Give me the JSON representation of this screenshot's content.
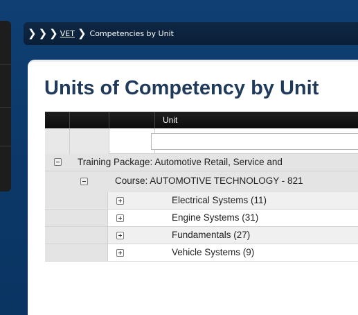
{
  "breadcrumb": {
    "link_label": "VET",
    "current_label": "Competencies by Unit"
  },
  "page": {
    "title": "Units of Competency by Unit"
  },
  "grid": {
    "column_headers": [
      "",
      "",
      "",
      "Unit"
    ],
    "filter": {
      "value": "",
      "placeholder": ""
    },
    "groups": [
      {
        "label": "Training Package: Automotive Retail, Service and",
        "expanded": true,
        "courses": [
          {
            "label": "Course: AUTOMOTIVE TECHNOLOGY - 821",
            "expanded": true,
            "units": [
              {
                "label": "Electrical Systems (11)",
                "expanded": false
              },
              {
                "label": "Engine Systems (31)",
                "expanded": false
              },
              {
                "label": "Fundamentals (27)",
                "expanded": false
              },
              {
                "label": "Vehicle Systems (9)",
                "expanded": false
              }
            ]
          }
        ]
      }
    ]
  },
  "icons": {
    "breadcrumb_separator": "chevron-right-icon",
    "collapse": "minus-box-icon",
    "expand": "plus-box-icon"
  },
  "colors": {
    "background": "#0b3868",
    "title": "#1f3a5a",
    "header": "#141414"
  }
}
